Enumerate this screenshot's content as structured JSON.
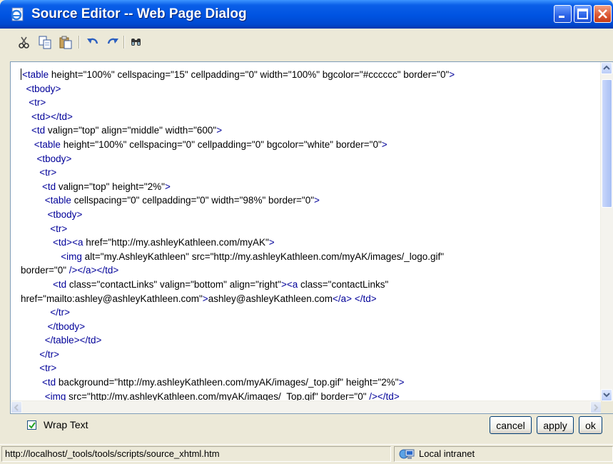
{
  "window": {
    "title": "Source Editor -- Web Page Dialog"
  },
  "toolbar": {
    "icons": [
      "cut-icon",
      "copy-icon",
      "paste-icon",
      "undo-icon",
      "redo-icon",
      "find-icon"
    ]
  },
  "editor": {
    "lines": [
      "<table height=\"100%\" cellspacing=\"15\" cellpadding=\"0\" width=\"100%\" bgcolor=\"#cccccc\" border=\"0\">",
      "  <tbody>",
      "   <tr>",
      "    <td></td>",
      "    <td valign=\"top\" align=\"middle\" width=\"600\">",
      "     <table height=\"100%\" cellspacing=\"0\" cellpadding=\"0\" bgcolor=\"white\" border=\"0\">",
      "      <tbody>",
      "       <tr>",
      "        <td valign=\"top\" height=\"2%\">",
      "         <table cellspacing=\"0\" cellpadding=\"0\" width=\"98%\" border=\"0\">",
      "          <tbody>",
      "           <tr>",
      "            <td><a href=\"http://my.ashleyKathleen.com/myAK\">",
      "               <img alt=\"my.AshleyKathleen\" src=\"http://my.ashleyKathleen.com/myAK/images/_logo.gif\"",
      "border=\"0\" /></a></td>",
      "            <td class=\"contactLinks\" valign=\"bottom\" align=\"right\"><a class=\"contactLinks\"",
      "href=\"mailto:ashley@ashleyKathleen.com\">ashley@ashleyKathleen.com</a> </td>",
      "           </tr>",
      "          </tbody>",
      "         </table></td>",
      "       </tr>",
      "       <tr>",
      "        <td background=\"http://my.ashleyKathleen.com/myAK/images/_top.gif\" height=\"2%\">",
      "         <img src=\"http://my.ashleyKathleen.com/myAK/images/_Top.gif\" border=\"0\" /></td>"
    ]
  },
  "options": {
    "wrap_text_label": "Wrap Text",
    "wrap_text_checked": true
  },
  "buttons": {
    "cancel": "cancel",
    "apply": "apply",
    "ok": "ok"
  },
  "status": {
    "url": "http://localhost/_tools/tools/scripts/source_xhtml.htm",
    "zone": "Local intranet"
  }
}
